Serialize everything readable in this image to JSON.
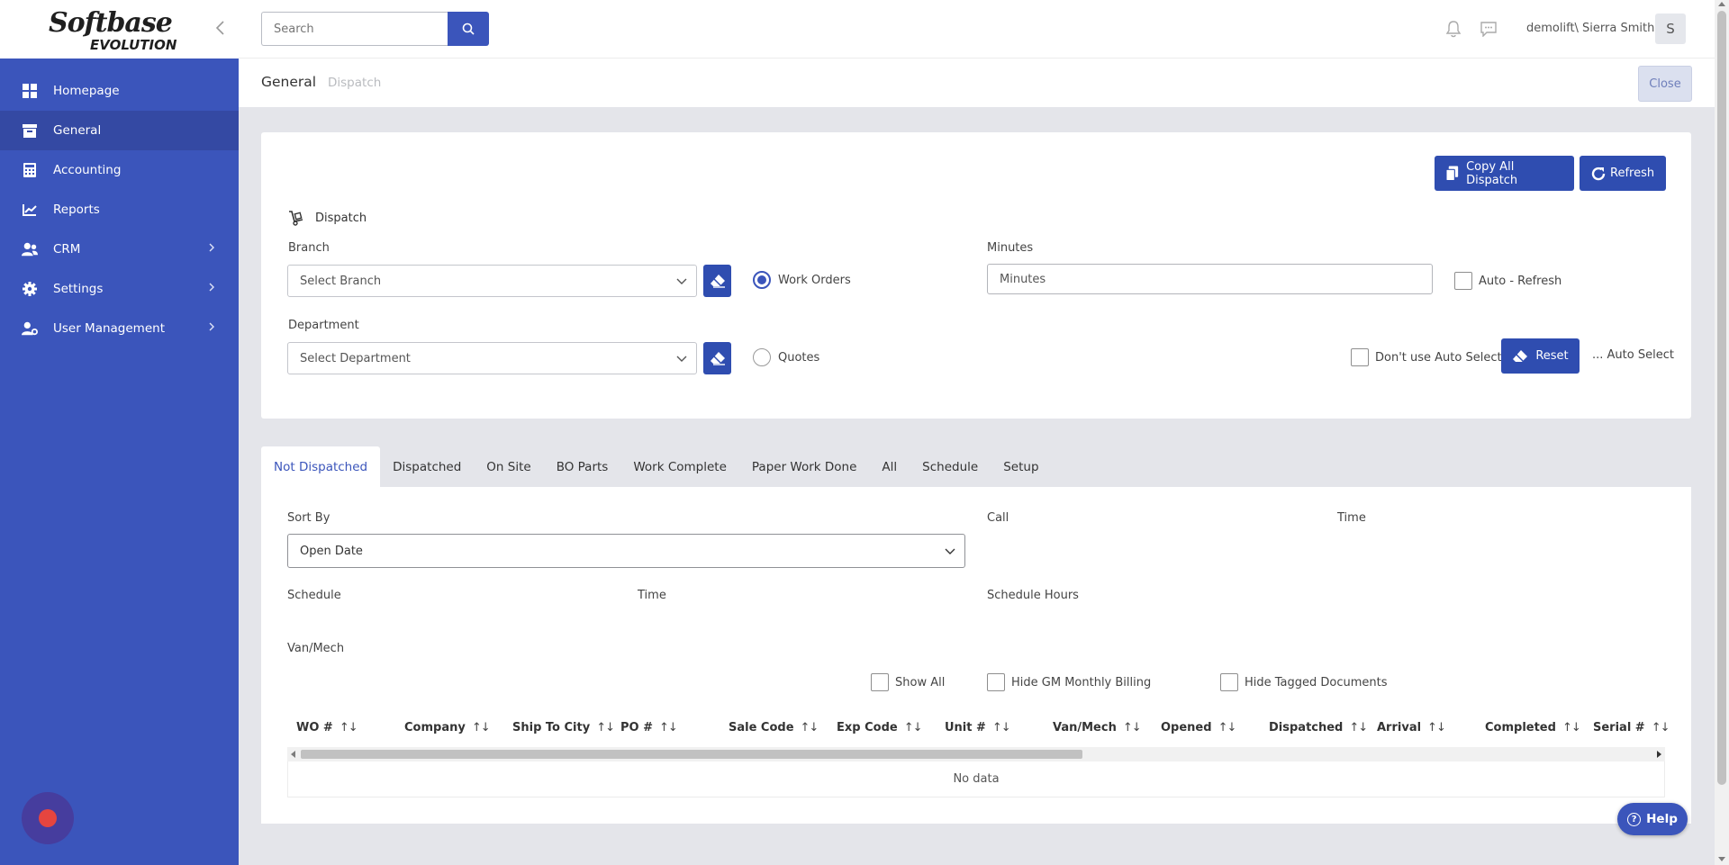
{
  "app": {
    "logo_line1": "Softbase",
    "logo_line2": "EVOLUTION"
  },
  "sidebar": {
    "items": [
      {
        "label": "Homepage",
        "icon": "grid-icon"
      },
      {
        "label": "General",
        "icon": "archive-box-icon",
        "active": true
      },
      {
        "label": "Accounting",
        "icon": "calculator-icon"
      },
      {
        "label": "Reports",
        "icon": "chart-line-icon"
      },
      {
        "label": "CRM",
        "icon": "users-icon",
        "has_children": true
      },
      {
        "label": "Settings",
        "icon": "gear-icon",
        "has_children": true
      },
      {
        "label": "User Management",
        "icon": "user-gear-icon",
        "has_children": true
      }
    ]
  },
  "topbar": {
    "search_placeholder": "Search",
    "user_name": "demolift\\ Sierra Smith",
    "avatar_initial": "S"
  },
  "breadcrumb": {
    "main": "General",
    "sub": "Dispatch"
  },
  "close_label": "Close",
  "filters": {
    "copy_all_label": "Copy All Dispatch",
    "refresh_label": "Refresh",
    "section_title": "Dispatch",
    "branch_label": "Branch",
    "branch_placeholder": "Select Branch",
    "department_label": "Department",
    "department_placeholder": "Select Department",
    "work_orders_label": "Work Orders",
    "quotes_label": "Quotes",
    "work_orders_selected": true,
    "minutes_label": "Minutes",
    "minutes_placeholder": "Minutes",
    "auto_refresh_label": "Auto - Refresh",
    "dont_use_auto_select_label": "Don't use Auto Select",
    "reset_label": "Reset",
    "auto_select_label": "... Auto Select"
  },
  "tabs": [
    {
      "label": "Not Dispatched",
      "active": true
    },
    {
      "label": "Dispatched"
    },
    {
      "label": "On Site"
    },
    {
      "label": "BO Parts"
    },
    {
      "label": "Work Complete"
    },
    {
      "label": "Paper Work Done"
    },
    {
      "label": "All"
    },
    {
      "label": "Schedule"
    },
    {
      "label": "Setup"
    }
  ],
  "grid_panel": {
    "sort_by_label": "Sort By",
    "sort_by_value": "Open Date",
    "call_label": "Call",
    "time_label": "Time",
    "schedule_label": "Schedule",
    "schedule_time_label": "Time",
    "schedule_hours_label": "Schedule Hours",
    "van_mech_label": "Van/Mech",
    "show_all_label": "Show All",
    "hide_gm_label": "Hide GM Monthly Billing",
    "hide_tagged_label": "Hide Tagged Documents",
    "columns": [
      "WO #",
      "Company",
      "Ship To City",
      "PO #",
      "Sale Code",
      "Exp Code",
      "Unit #",
      "Van/Mech",
      "Opened",
      "Dispatched",
      "Arrival",
      "Completed",
      "Serial #"
    ],
    "empty_text": "No data"
  },
  "help_label": "Help",
  "colors": {
    "primary": "#3b55bb",
    "sidebar_active": "#3449a3",
    "record_dot": "#e6453f"
  }
}
